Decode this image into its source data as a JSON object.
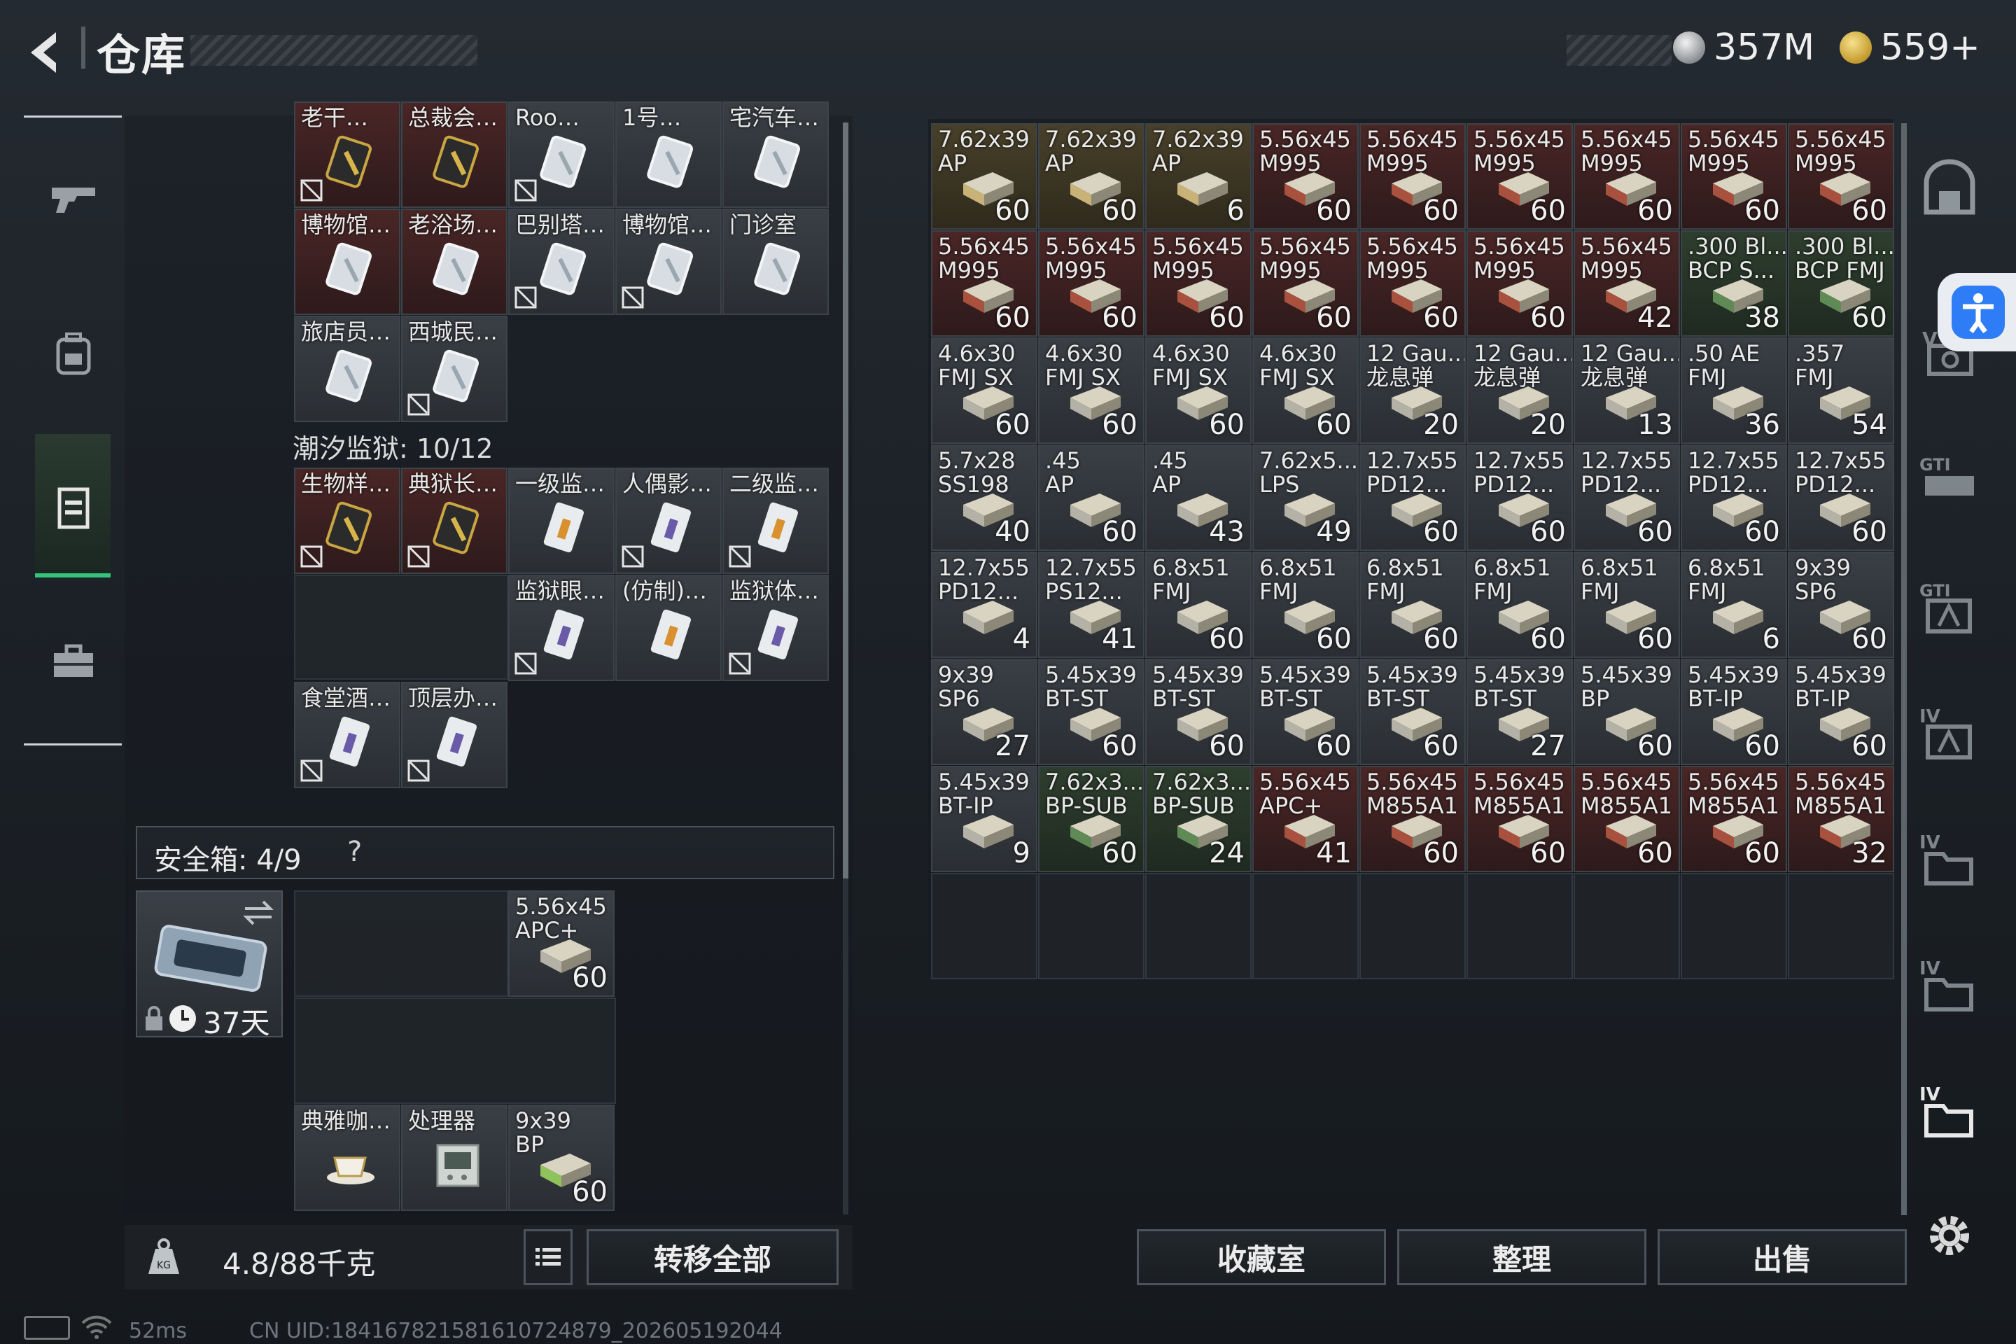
{
  "header": {
    "title": "仓库",
    "currency1": "357M",
    "currency2": "559+"
  },
  "left": {
    "section_tide_prison": "潮汐监狱: 10/12",
    "safebox_label": "安全箱: 4/9",
    "safebox_help": "?",
    "safebox_days": "37天",
    "weight": "4.8/88千克",
    "transfer_all": "转移全部",
    "keys_top": [
      {
        "n": "老干…",
        "c": "red",
        "k": "gold",
        "lock": true
      },
      {
        "n": "总裁会…",
        "c": "red",
        "k": "gold",
        "lock": false
      },
      {
        "n": "Roo…",
        "c": "gray",
        "k": "white",
        "lock": true
      },
      {
        "n": "1号…",
        "c": "gray",
        "k": "white",
        "lock": false
      },
      {
        "n": "宅汽车…",
        "c": "gray",
        "k": "white",
        "lock": false
      },
      {
        "n": "博物馆…",
        "c": "red",
        "k": "white",
        "lock": false
      },
      {
        "n": "老浴场…",
        "c": "red",
        "k": "white",
        "lock": false
      },
      {
        "n": "巴别塔…",
        "c": "gray",
        "k": "white",
        "lock": true
      },
      {
        "n": "博物馆…",
        "c": "gray",
        "k": "white",
        "lock": true
      },
      {
        "n": "门诊室",
        "c": "gray",
        "k": "white",
        "lock": false
      },
      {
        "n": "旅店员…",
        "c": "gray",
        "k": "white",
        "lock": false
      },
      {
        "n": "西城民…",
        "c": "gray",
        "k": "white",
        "lock": true
      }
    ],
    "keys_prison": [
      {
        "n": "生物样…",
        "c": "red",
        "k": "gold",
        "lock": true
      },
      {
        "n": "典狱长…",
        "c": "red",
        "k": "gold",
        "lock": true
      },
      {
        "n": "一级监…",
        "c": "gray",
        "k": "card-orange",
        "lock": false
      },
      {
        "n": "人偶影…",
        "c": "gray",
        "k": "card-purple",
        "lock": true
      },
      {
        "n": "二级监…",
        "c": "gray",
        "k": "card-orange",
        "lock": true
      },
      {
        "n": "监狱眼…",
        "c": "gray",
        "k": "card-purple",
        "lock": true
      },
      {
        "n": "(仿制)…",
        "c": "gray",
        "k": "card-orange",
        "lock": false
      },
      {
        "n": "监狱体…",
        "c": "gray",
        "k": "card-purple",
        "lock": true
      },
      {
        "n": "食堂酒…",
        "c": "gray",
        "k": "card-purple",
        "lock": true
      },
      {
        "n": "顶层办…",
        "c": "gray",
        "k": "card-purple",
        "lock": true
      }
    ],
    "safebox_items": [
      {
        "n": "5.56x45\nAPC+",
        "q": "60",
        "c": "gray",
        "k": "ammo"
      },
      {
        "n": "典雅咖…",
        "q": "",
        "c": "gray",
        "k": "cup"
      },
      {
        "n": "处理器",
        "q": "",
        "c": "gray",
        "k": "cpu"
      },
      {
        "n": "9x39\nBP",
        "q": "60",
        "c": "gray",
        "k": "ammo-green"
      }
    ]
  },
  "stash": {
    "items": [
      {
        "n": "7.62x39\nAP",
        "q": "60",
        "c": "yellow"
      },
      {
        "n": "7.62x39\nAP",
        "q": "60",
        "c": "yellow"
      },
      {
        "n": "7.62x39\nAP",
        "q": "6",
        "c": "yellow"
      },
      {
        "n": "5.56x45\nM995",
        "q": "60",
        "c": "red"
      },
      {
        "n": "5.56x45\nM995",
        "q": "60",
        "c": "red"
      },
      {
        "n": "5.56x45\nM995",
        "q": "60",
        "c": "red"
      },
      {
        "n": "5.56x45\nM995",
        "q": "60",
        "c": "red"
      },
      {
        "n": "5.56x45\nM995",
        "q": "60",
        "c": "red"
      },
      {
        "n": "5.56x45\nM995",
        "q": "60",
        "c": "red"
      },
      {
        "n": "5.56x45\nM995",
        "q": "60",
        "c": "red"
      },
      {
        "n": "5.56x45\nM995",
        "q": "60",
        "c": "red"
      },
      {
        "n": "5.56x45\nM995",
        "q": "60",
        "c": "red"
      },
      {
        "n": "5.56x45\nM995",
        "q": "60",
        "c": "red"
      },
      {
        "n": "5.56x45\nM995",
        "q": "60",
        "c": "red"
      },
      {
        "n": "5.56x45\nM995",
        "q": "60",
        "c": "red"
      },
      {
        "n": "5.56x45\nM995",
        "q": "42",
        "c": "red"
      },
      {
        "n": ".300 Bl...\nBCP S...",
        "q": "38",
        "c": "green"
      },
      {
        "n": ".300 Bl...\nBCP FMJ",
        "q": "60",
        "c": "green"
      },
      {
        "n": "4.6x30\nFMJ SX",
        "q": "60",
        "c": "gray"
      },
      {
        "n": "4.6x30\nFMJ SX",
        "q": "60",
        "c": "gray"
      },
      {
        "n": "4.6x30\nFMJ SX",
        "q": "60",
        "c": "gray"
      },
      {
        "n": "4.6x30\nFMJ SX",
        "q": "60",
        "c": "gray"
      },
      {
        "n": "12 Gau...\n龙息弹",
        "q": "20",
        "c": "gray"
      },
      {
        "n": "12 Gau...\n龙息弹",
        "q": "20",
        "c": "gray"
      },
      {
        "n": "12 Gau...\n龙息弹",
        "q": "13",
        "c": "gray"
      },
      {
        "n": ".50 AE\nFMJ",
        "q": "36",
        "c": "gray"
      },
      {
        "n": ".357\nFMJ",
        "q": "54",
        "c": "gray"
      },
      {
        "n": "5.7x28\nSS198",
        "q": "40",
        "c": "gray"
      },
      {
        "n": ".45\nAP",
        "q": "60",
        "c": "gray"
      },
      {
        "n": ".45\nAP",
        "q": "43",
        "c": "gray"
      },
      {
        "n": "7.62x5...\nLPS",
        "q": "49",
        "c": "gray"
      },
      {
        "n": "12.7x55\nPD12...",
        "q": "60",
        "c": "gray"
      },
      {
        "n": "12.7x55\nPD12...",
        "q": "60",
        "c": "gray"
      },
      {
        "n": "12.7x55\nPD12...",
        "q": "60",
        "c": "gray"
      },
      {
        "n": "12.7x55\nPD12...",
        "q": "60",
        "c": "gray"
      },
      {
        "n": "12.7x55\nPD12...",
        "q": "60",
        "c": "gray"
      },
      {
        "n": "12.7x55\nPD12...",
        "q": "4",
        "c": "gray"
      },
      {
        "n": "12.7x55\nPS12...",
        "q": "41",
        "c": "gray"
      },
      {
        "n": "6.8x51\nFMJ",
        "q": "60",
        "c": "gray"
      },
      {
        "n": "6.8x51\nFMJ",
        "q": "60",
        "c": "gray"
      },
      {
        "n": "6.8x51\nFMJ",
        "q": "60",
        "c": "gray"
      },
      {
        "n": "6.8x51\nFMJ",
        "q": "60",
        "c": "gray"
      },
      {
        "n": "6.8x51\nFMJ",
        "q": "60",
        "c": "gray"
      },
      {
        "n": "6.8x51\nFMJ",
        "q": "6",
        "c": "gray"
      },
      {
        "n": "9x39\nSP6",
        "q": "60",
        "c": "gray"
      },
      {
        "n": "9x39\nSP6",
        "q": "27",
        "c": "gray"
      },
      {
        "n": "5.45x39\nBT-ST",
        "q": "60",
        "c": "gray"
      },
      {
        "n": "5.45x39\nBT-ST",
        "q": "60",
        "c": "gray"
      },
      {
        "n": "5.45x39\nBT-ST",
        "q": "60",
        "c": "gray"
      },
      {
        "n": "5.45x39\nBT-ST",
        "q": "60",
        "c": "gray"
      },
      {
        "n": "5.45x39\nBT-ST",
        "q": "27",
        "c": "gray"
      },
      {
        "n": "5.45x39\nBP",
        "q": "60",
        "c": "gray"
      },
      {
        "n": "5.45x39\nBT-IP",
        "q": "60",
        "c": "gray"
      },
      {
        "n": "5.45x39\nBT-IP",
        "q": "60",
        "c": "gray"
      },
      {
        "n": "5.45x39\nBT-IP",
        "q": "9",
        "c": "gray"
      },
      {
        "n": "7.62x3...\nBP-SUB",
        "q": "60",
        "c": "green"
      },
      {
        "n": "7.62x3...\nBP-SUB",
        "q": "24",
        "c": "green"
      },
      {
        "n": "5.56x45\nAPC+",
        "q": "41",
        "c": "red"
      },
      {
        "n": "5.56x45\nM855A1",
        "q": "60",
        "c": "red"
      },
      {
        "n": "5.56x45\nM855A1",
        "q": "60",
        "c": "red"
      },
      {
        "n": "5.56x45\nM855A1",
        "q": "60",
        "c": "red"
      },
      {
        "n": "5.56x45\nM855A1",
        "q": "60",
        "c": "red"
      },
      {
        "n": "5.56x45\nM855A1",
        "q": "32",
        "c": "red"
      }
    ],
    "btn_collection": "收藏室",
    "btn_sort": "整理",
    "btn_sell": "出售"
  },
  "status": {
    "ping": "52ms",
    "uid": "CN UID:184167821581610724879_202605192044"
  }
}
